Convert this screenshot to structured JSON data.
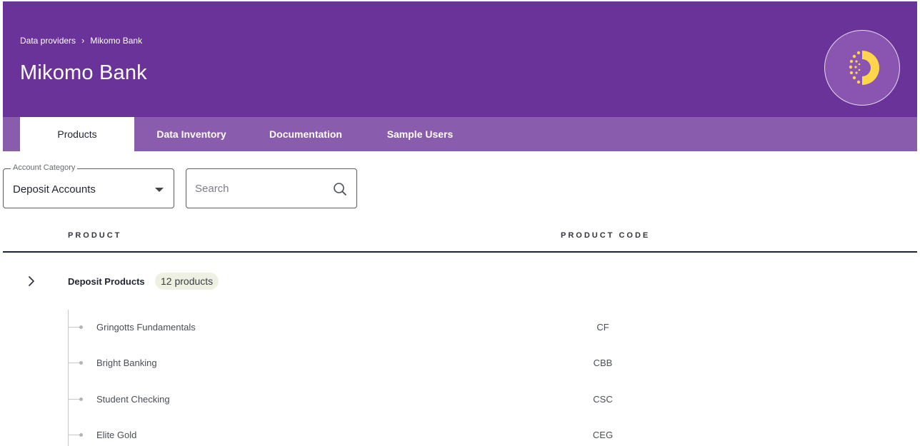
{
  "header": {
    "breadcrumb": [
      "Data providers",
      "Mikomo Bank"
    ],
    "breadcrumb_separator": "›",
    "title": "Mikomo Bank",
    "background_color": "#6a3399",
    "logo_icon": "provider-logo-icon",
    "logo_colors": {
      "ring": "#ffd54a",
      "circle": "#8955b1"
    }
  },
  "tabs": [
    {
      "label": "Products",
      "active": true
    },
    {
      "label": "Data Inventory",
      "active": false
    },
    {
      "label": "Documentation",
      "active": false
    },
    {
      "label": "Sample Users",
      "active": false
    }
  ],
  "filters": {
    "category": {
      "label": "Account Category",
      "value": "Deposit Accounts"
    },
    "search": {
      "placeholder": "Search",
      "value": ""
    }
  },
  "table": {
    "columns": [
      "PRODUCT",
      "PRODUCT CODE"
    ],
    "group": {
      "name": "Deposit Products",
      "count_label": "12 products",
      "expand_icon": "chevron-right-icon"
    },
    "rows": [
      {
        "name": "Gringotts Fundamentals",
        "code": "CF"
      },
      {
        "name": "Bright Banking",
        "code": "CBB"
      },
      {
        "name": "Student Checking",
        "code": "CSC"
      },
      {
        "name": "Elite Gold",
        "code": "CEG"
      }
    ]
  }
}
